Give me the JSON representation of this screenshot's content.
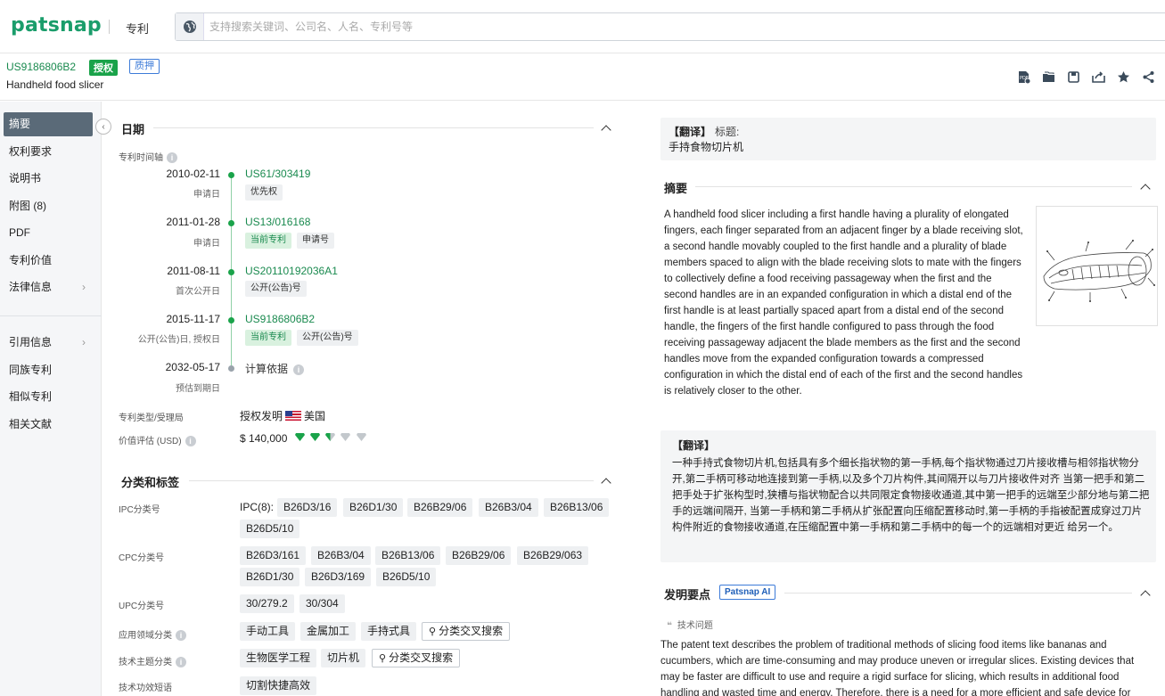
{
  "app": {
    "logo": "patsnap",
    "product": "专利"
  },
  "search": {
    "placeholder": "支持搜索关键词、公司名、人名、专利号等"
  },
  "patent": {
    "number": "US9186806B2",
    "status_badge": "授权",
    "pledge_badge": "质押",
    "title": "Handheld food slicer"
  },
  "header_icons": [
    "pdf-icon",
    "folder-icon",
    "save-icon",
    "share-out-icon",
    "star-icon",
    "share-icon"
  ],
  "sidebar": {
    "items": [
      {
        "label": "摘要",
        "active": true
      },
      {
        "label": "权利要求"
      },
      {
        "label": "说明书"
      },
      {
        "label": "附图 (8)"
      },
      {
        "label": "PDF"
      },
      {
        "label": "专利价值"
      },
      {
        "label": "法律信息",
        "chevron": true
      },
      {
        "label": "引用信息",
        "chevron": true
      },
      {
        "label": "同族专利"
      },
      {
        "label": "相似专利"
      },
      {
        "label": "相关文献"
      }
    ]
  },
  "dates": {
    "title": "日期",
    "timeline_label": "专利时间轴",
    "events": [
      {
        "date": "2010-02-11",
        "sub": "申请日",
        "link": "US61/303419",
        "tags": [
          "优先权"
        ]
      },
      {
        "date": "2011-01-28",
        "sub": "申请日",
        "link": "US13/016168",
        "tags": [
          "当前专利",
          "申请号"
        ]
      },
      {
        "date": "2011-08-11",
        "sub": "首次公开日",
        "link": "US20110192036A1",
        "tags": [
          "公开(公告)号"
        ]
      },
      {
        "date": "2015-11-17",
        "sub": "公开(公告)日, 授权日",
        "link": "US9186806B2",
        "tags": [
          "当前专利",
          "公开(公告)号"
        ]
      },
      {
        "date": "2032-05-17",
        "sub": "预估到期日",
        "text": "计算依据"
      }
    ],
    "type_label": "专利类型/受理局",
    "type_value": "授权发明",
    "country": "美国",
    "value_label": "价值评估 (USD)",
    "value": "$ 140,000",
    "value_rating": 2.5,
    "value_rating_max": 5
  },
  "classification": {
    "title": "分类和标签",
    "ipc_label": "IPC分类号",
    "ipc_prefix": "IPC(8):",
    "ipc": [
      "B26D3/16",
      "B26D1/30",
      "B26B29/06",
      "B26B3/04",
      "B26B13/06",
      "B26D5/10"
    ],
    "cpc_label": "CPC分类号",
    "cpc": [
      "B26D3/161",
      "B26B3/04",
      "B26B13/06",
      "B26B29/06",
      "B26B29/063",
      "B26D1/30",
      "B26D3/169",
      "B26D5/10"
    ],
    "upc_label": "UPC分类号",
    "upc": [
      "30/279.2",
      "30/304"
    ],
    "app_field_label": "应用领域分类",
    "app_field": [
      "手动工具",
      "金属加工",
      "手持式具"
    ],
    "cross_search": "分类交叉搜索",
    "tech_topic_label": "技术主题分类",
    "tech_topic": [
      "生物医学工程",
      "切片机"
    ],
    "tech_effect_label": "技术功效短语",
    "tech_effect": [
      "切割快捷高效"
    ]
  },
  "right": {
    "trans_title_label": "【翻译】",
    "trans_title_key": "标题:",
    "trans_title_value": "手持食物切片机",
    "abstract_title": "摘要",
    "abstract_text": "A handheld food slicer including a first handle having a plurality of elongated fingers, each finger separated from an adjacent finger by a blade receiving slot, a second handle movably coupled to the first handle and a plurality of blade members spaced to align with the blade receiving slots to mate with the fingers to collectively define a food receiving passageway when the first and the second handles are in an expanded configuration in which a distal end of the first handle is at least partially spaced apart from a distal end of the second handle, the fingers of the first handle configured to pass through the food receiving passageway adjacent the blade members as the first and the second handles move from the expanded configuration towards a compressed configuration in which the distal end of each of the first and the second handles is relatively closer to the other.",
    "trans_abstract_label": "【翻译】",
    "trans_abstract": "一种手持式食物切片机,包括具有多个细长指状物的第一手柄,每个指状物通过刀片接收槽与相邻指状物分开,第二手柄可移动地连接到第一手柄,以及多个刀片构件,其间隔开以与刀片接收件对齐 当第一把手和第二把手处于扩张构型时,狭槽与指状物配合以共同限定食物接收通道,其中第一把手的远端至少部分地与第二把手的远端间隔开, 当第一手柄和第二手柄从扩张配置向压缩配置移动时,第一手柄的手指被配置成穿过刀片构件附近的食物接收通道,在压缩配置中第一手柄和第二手柄中的每一个的远端相对更近 给另一个。",
    "key_points_title": "发明要点",
    "ai_badge": "Patsnap AI",
    "tech_problem_label": "技术问题",
    "tech_problem_text": "The patent text describes the problem of traditional methods of slicing food items like bananas and cucumbers, which are time-consuming and may produce uneven or irregular slices. Existing devices that may be faster are difficult to use and require a rigid surface for slicing, which results in additional food handling and wasted time and energy. Therefore, there is a need for a more efficient and safe device for"
  }
}
